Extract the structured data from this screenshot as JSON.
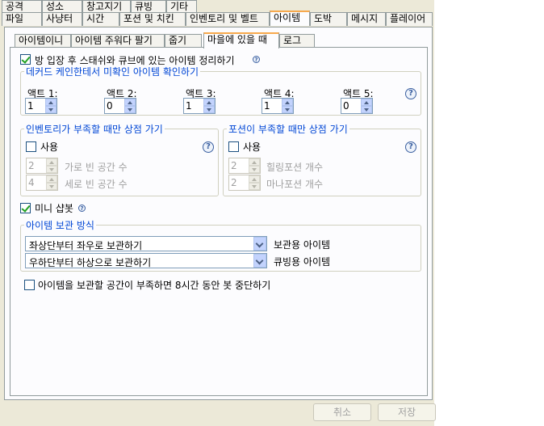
{
  "tabs_row1": [
    "공격",
    "성소",
    "창고지기",
    "큐빙",
    "기타"
  ],
  "tabs_row2": [
    "파일",
    "사냥터",
    "시간",
    "포션 및 치킨",
    "인벤토리 및 벨트",
    "아이템",
    "도박",
    "메시지",
    "플레이어"
  ],
  "subtabs": [
    "아이템이니",
    "아이템 주워다 팔기",
    "줍기",
    "마을에 있을 때",
    "로그"
  ],
  "active_tab": "아이템",
  "active_subtab": "마을에 있을 때",
  "stash_cube_label": "방 입장 후 스태쉬와 큐브에 있는 아이템 정리하기",
  "deckard": {
    "title": "데커드 케인한테서 미확인 아이템 확인하기",
    "acts": [
      {
        "label": "액트 1:",
        "value": "1"
      },
      {
        "label": "액트 2:",
        "value": "0"
      },
      {
        "label": "액트 3:",
        "value": "1"
      },
      {
        "label": "액트 4:",
        "value": "1"
      },
      {
        "label": "액트 5:",
        "value": "0"
      }
    ]
  },
  "inventory_group": {
    "title": "인벤토리가 부족할 때만 상점 가기",
    "use_label": "사용",
    "width_label": "가로 빈 공간 수",
    "width_value": "2",
    "height_label": "세로 빈 공간 수",
    "height_value": "4"
  },
  "potion_group": {
    "title": "포션이 부족할 때만 상점 가기",
    "use_label": "사용",
    "heal_label": "힐링포션 개수",
    "heal_value": "2",
    "mana_label": "마나포션 개수",
    "mana_value": "2"
  },
  "mini_shop_label": "미니 샵봇",
  "storage": {
    "title": "아이템 보관 방식",
    "stash_combo": "좌상단부터 좌우로 보관하기",
    "stash_label": "보관용 아이템",
    "cube_combo": "우하단부터 하상으로 보관하기",
    "cube_label": "큐빙용 아이템"
  },
  "stop_bot_label": "아이템을 보관할 공간이 부족하면 8시간 동안 봇 중단하기",
  "buttons": {
    "cancel": "취소",
    "save": "저장"
  },
  "help_glyph": "?"
}
